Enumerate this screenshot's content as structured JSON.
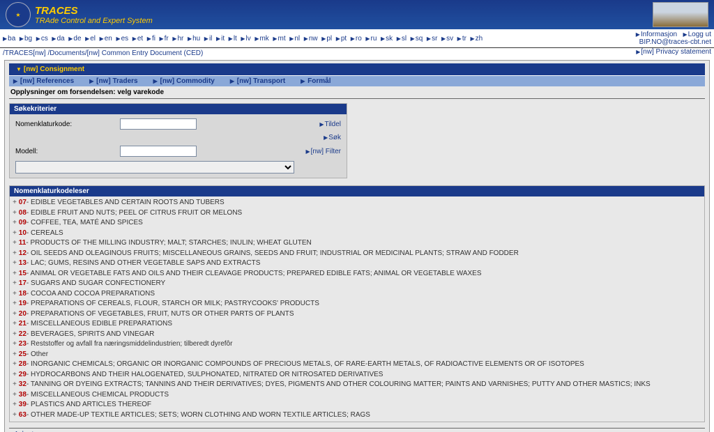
{
  "header": {
    "title": "TRACES",
    "subtitle": "TRAde Control and Expert System"
  },
  "languages": [
    "ba",
    "bg",
    "cs",
    "da",
    "de",
    "el",
    "en",
    "es",
    "et",
    "fi",
    "fr",
    "hr",
    "hu",
    "il",
    "it",
    "lt",
    "lv",
    "mk",
    "mt",
    "nl",
    "nw",
    "pl",
    "pt",
    "ro",
    "ru",
    "sk",
    "sl",
    "sq",
    "sr",
    "sv",
    "tr",
    "zh"
  ],
  "topRight": {
    "info": "Informasjon",
    "logout": "Logg ut",
    "email": "BIP.NO@traces-cbt.net"
  },
  "breadcrumb": {
    "seg1": "/TRACES",
    "seg2": "[nw]",
    "seg3": "/Documents/",
    "seg4": "[nw] Common Entry Document (CED)"
  },
  "privacy": "[nw] Privacy statement",
  "tabs": {
    "main_active": "[nw] Consignment",
    "sub": [
      "[nw] References",
      "[nw] Traders",
      "[nw] Commodity",
      "[nw] Transport",
      "Formål"
    ]
  },
  "sectionTitle": "Opplysninger om forsendelsen: velg varekode",
  "search": {
    "header": "Søkekriterier",
    "nomenklaturkode_label": "Nomenklaturkode:",
    "tildel": "Tildel",
    "sok": "Søk",
    "modell_label": "Modell:",
    "filter": "[nw] Filter"
  },
  "browser": {
    "header": "Nomenklaturkodeleser",
    "items": [
      {
        "code": "07",
        "desc": "- EDIBLE VEGETABLES AND CERTAIN ROOTS AND TUBERS"
      },
      {
        "code": "08",
        "desc": "- EDIBLE FRUIT AND NUTS; PEEL OF CITRUS FRUIT OR MELONS"
      },
      {
        "code": "09",
        "desc": "- COFFEE, TEA, MATÉ AND SPICES"
      },
      {
        "code": "10",
        "desc": "- CEREALS"
      },
      {
        "code": "11",
        "desc": "- PRODUCTS OF THE MILLING INDUSTRY; MALT; STARCHES; INULIN; WHEAT GLUTEN"
      },
      {
        "code": "12",
        "desc": "- OIL SEEDS AND OLEAGINOUS FRUITS; MISCELLANEOUS GRAINS, SEEDS AND FRUIT; INDUSTRIAL OR MEDICINAL PLANTS; STRAW AND FODDER"
      },
      {
        "code": "13",
        "desc": "- LAC; GUMS, RESINS AND OTHER VEGETABLE SAPS AND EXTRACTS"
      },
      {
        "code": "15",
        "desc": "- ANIMAL OR VEGETABLE FATS AND OILS AND THEIR CLEAVAGE PRODUCTS; PREPARED EDIBLE FATS; ANIMAL OR VEGETABLE WAXES"
      },
      {
        "code": "17",
        "desc": "- SUGARS AND SUGAR CONFECTIONERY"
      },
      {
        "code": "18",
        "desc": "- COCOA AND COCOA PREPARATIONS"
      },
      {
        "code": "19",
        "desc": "- PREPARATIONS OF CEREALS, FLOUR, STARCH OR MILK; PASTRYCOOKS' PRODUCTS"
      },
      {
        "code": "20",
        "desc": "- PREPARATIONS OF VEGETABLES, FRUIT, NUTS OR OTHER PARTS OF PLANTS"
      },
      {
        "code": "21",
        "desc": "- MISCELLANEOUS EDIBLE PREPARATIONS"
      },
      {
        "code": "22",
        "desc": "- BEVERAGES, SPIRITS AND VINEGAR"
      },
      {
        "code": "23",
        "desc": "- Reststoffer og avfall fra næringsmiddelindustrien; tilberedt dyrefôr"
      },
      {
        "code": "25",
        "desc": "- Other"
      },
      {
        "code": "28",
        "desc": "- INORGANIC CHEMICALS; ORGANIC OR INORGANIC COMPOUNDS OF PRECIOUS METALS, OF RARE-EARTH METALS, OF RADIOACTIVE ELEMENTS OR OF ISOTOPES"
      },
      {
        "code": "29",
        "desc": "- HYDROCARBONS AND THEIR HALOGENATED, SULPHONATED, NITRATED OR NITROSATED DERIVATIVES"
      },
      {
        "code": "32",
        "desc": "- TANNING OR DYEING EXTRACTS; TANNINS AND THEIR DERIVATIVES; DYES, PIGMENTS AND OTHER COLOURING MATTER; PAINTS AND VARNISHES; PUTTY AND OTHER MASTICS; INKS"
      },
      {
        "code": "38",
        "desc": "- MISCELLANEOUS CHEMICAL PRODUCTS"
      },
      {
        "code": "39",
        "desc": "- PLASTICS AND ARTICLES THEREOF"
      },
      {
        "code": "63",
        "desc": "- OTHER MADE-UP TEXTILE ARTICLES; SETS; WORN CLOTHING AND WORN TEXTILE ARTICLES; RAGS"
      }
    ]
  },
  "bottomLink": "Avbryt"
}
